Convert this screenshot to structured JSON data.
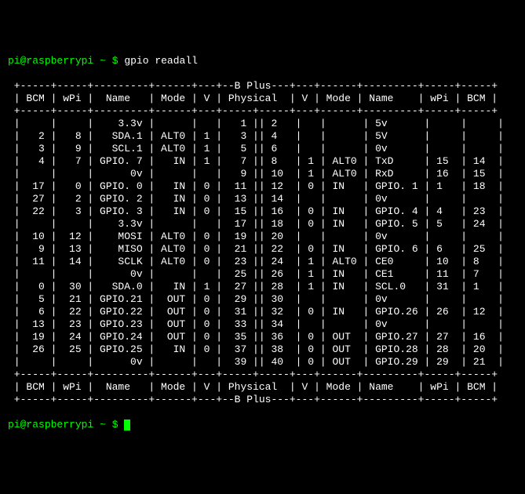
{
  "prompt": {
    "user": "pi",
    "host": "raspberrypi",
    "cwd": "~",
    "symbol": "$",
    "command": "gpio readall"
  },
  "table": {
    "model": "B Plus",
    "headers": [
      "BCM",
      "wPi",
      "Name",
      "Mode",
      "V",
      "Physical",
      "V",
      "Mode",
      "Name",
      "wPi",
      "BCM"
    ],
    "rows": [
      {
        "bcmL": "",
        "wpiL": "",
        "nameL": "3.3v",
        "modeL": "",
        "vL": "",
        "physL": "1",
        "physR": "2",
        "vR": "",
        "modeR": "",
        "nameR": "5v",
        "wpiR": "",
        "bcmR": ""
      },
      {
        "bcmL": "2",
        "wpiL": "8",
        "nameL": "SDA.1",
        "modeL": "ALT0",
        "vL": "1",
        "physL": "3",
        "physR": "4",
        "vR": "",
        "modeR": "",
        "nameR": "5V",
        "wpiR": "",
        "bcmR": ""
      },
      {
        "bcmL": "3",
        "wpiL": "9",
        "nameL": "SCL.1",
        "modeL": "ALT0",
        "vL": "1",
        "physL": "5",
        "physR": "6",
        "vR": "",
        "modeR": "",
        "nameR": "0v",
        "wpiR": "",
        "bcmR": ""
      },
      {
        "bcmL": "4",
        "wpiL": "7",
        "nameL": "GPIO. 7",
        "modeL": "IN",
        "vL": "1",
        "physL": "7",
        "physR": "8",
        "vR": "1",
        "modeR": "ALT0",
        "nameR": "TxD",
        "wpiR": "15",
        "bcmR": "14"
      },
      {
        "bcmL": "",
        "wpiL": "",
        "nameL": "0v",
        "modeL": "",
        "vL": "",
        "physL": "9",
        "physR": "10",
        "vR": "1",
        "modeR": "ALT0",
        "nameR": "RxD",
        "wpiR": "16",
        "bcmR": "15"
      },
      {
        "bcmL": "17",
        "wpiL": "0",
        "nameL": "GPIO. 0",
        "modeL": "IN",
        "vL": "0",
        "physL": "11",
        "physR": "12",
        "vR": "0",
        "modeR": "IN",
        "nameR": "GPIO. 1",
        "wpiR": "1",
        "bcmR": "18"
      },
      {
        "bcmL": "27",
        "wpiL": "2",
        "nameL": "GPIO. 2",
        "modeL": "IN",
        "vL": "0",
        "physL": "13",
        "physR": "14",
        "vR": "",
        "modeR": "",
        "nameR": "0v",
        "wpiR": "",
        "bcmR": ""
      },
      {
        "bcmL": "22",
        "wpiL": "3",
        "nameL": "GPIO. 3",
        "modeL": "IN",
        "vL": "0",
        "physL": "15",
        "physR": "16",
        "vR": "0",
        "modeR": "IN",
        "nameR": "GPIO. 4",
        "wpiR": "4",
        "bcmR": "23"
      },
      {
        "bcmL": "",
        "wpiL": "",
        "nameL": "3.3v",
        "modeL": "",
        "vL": "",
        "physL": "17",
        "physR": "18",
        "vR": "0",
        "modeR": "IN",
        "nameR": "GPIO. 5",
        "wpiR": "5",
        "bcmR": "24"
      },
      {
        "bcmL": "10",
        "wpiL": "12",
        "nameL": "MOSI",
        "modeL": "ALT0",
        "vL": "0",
        "physL": "19",
        "physR": "20",
        "vR": "",
        "modeR": "",
        "nameR": "0v",
        "wpiR": "",
        "bcmR": ""
      },
      {
        "bcmL": "9",
        "wpiL": "13",
        "nameL": "MISO",
        "modeL": "ALT0",
        "vL": "0",
        "physL": "21",
        "physR": "22",
        "vR": "0",
        "modeR": "IN",
        "nameR": "GPIO. 6",
        "wpiR": "6",
        "bcmR": "25"
      },
      {
        "bcmL": "11",
        "wpiL": "14",
        "nameL": "SCLK",
        "modeL": "ALT0",
        "vL": "0",
        "physL": "23",
        "physR": "24",
        "vR": "1",
        "modeR": "ALT0",
        "nameR": "CE0",
        "wpiR": "10",
        "bcmR": "8"
      },
      {
        "bcmL": "",
        "wpiL": "",
        "nameL": "0v",
        "modeL": "",
        "vL": "",
        "physL": "25",
        "physR": "26",
        "vR": "1",
        "modeR": "IN",
        "nameR": "CE1",
        "wpiR": "11",
        "bcmR": "7"
      },
      {
        "bcmL": "0",
        "wpiL": "30",
        "nameL": "SDA.0",
        "modeL": "IN",
        "vL": "1",
        "physL": "27",
        "physR": "28",
        "vR": "1",
        "modeR": "IN",
        "nameR": "SCL.0",
        "wpiR": "31",
        "bcmR": "1"
      },
      {
        "bcmL": "5",
        "wpiL": "21",
        "nameL": "GPIO.21",
        "modeL": "OUT",
        "vL": "0",
        "physL": "29",
        "physR": "30",
        "vR": "",
        "modeR": "",
        "nameR": "0v",
        "wpiR": "",
        "bcmR": ""
      },
      {
        "bcmL": "6",
        "wpiL": "22",
        "nameL": "GPIO.22",
        "modeL": "OUT",
        "vL": "0",
        "physL": "31",
        "physR": "32",
        "vR": "0",
        "modeR": "IN",
        "nameR": "GPIO.26",
        "wpiR": "26",
        "bcmR": "12"
      },
      {
        "bcmL": "13",
        "wpiL": "23",
        "nameL": "GPIO.23",
        "modeL": "OUT",
        "vL": "0",
        "physL": "33",
        "physR": "34",
        "vR": "",
        "modeR": "",
        "nameR": "0v",
        "wpiR": "",
        "bcmR": ""
      },
      {
        "bcmL": "19",
        "wpiL": "24",
        "nameL": "GPIO.24",
        "modeL": "OUT",
        "vL": "0",
        "physL": "35",
        "physR": "36",
        "vR": "0",
        "modeR": "OUT",
        "nameR": "GPIO.27",
        "wpiR": "27",
        "bcmR": "16"
      },
      {
        "bcmL": "26",
        "wpiL": "25",
        "nameL": "GPIO.25",
        "modeL": "IN",
        "vL": "0",
        "physL": "37",
        "physR": "38",
        "vR": "0",
        "modeR": "OUT",
        "nameR": "GPIO.28",
        "wpiR": "28",
        "bcmR": "20"
      },
      {
        "bcmL": "",
        "wpiL": "",
        "nameL": "0v",
        "modeL": "",
        "vL": "",
        "physL": "39",
        "physR": "40",
        "vR": "0",
        "modeR": "OUT",
        "nameR": "GPIO.29",
        "wpiR": "29",
        "bcmR": "21"
      }
    ]
  }
}
